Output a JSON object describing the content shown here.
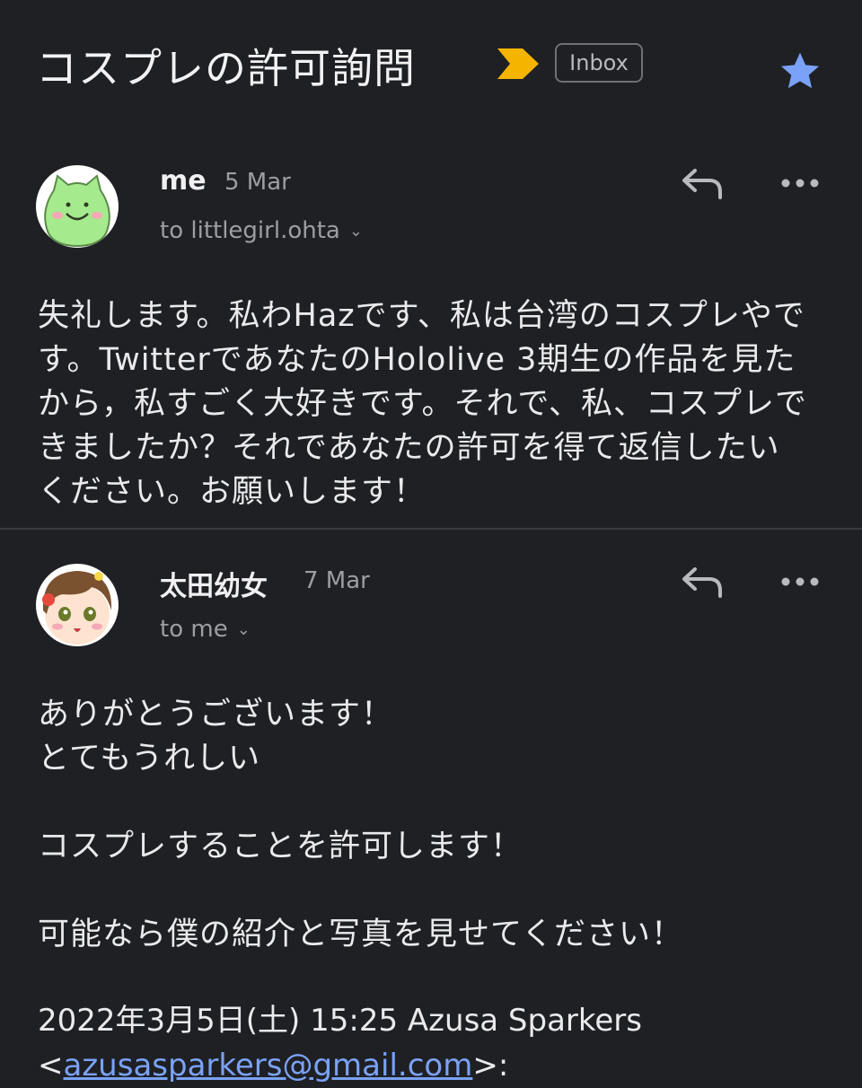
{
  "thread": {
    "subject": "コスプレの許可詢問",
    "label": "Inbox",
    "starred": true,
    "colors": {
      "background": "#1f2024",
      "importance": "#f5b400",
      "star": "#7aa2f7",
      "link": "#7aa2f7"
    }
  },
  "messages": [
    {
      "sender": "me",
      "date": "5 Mar",
      "recipient": "to littlegirl.ohta",
      "avatar_icon": "green-blob-avatar",
      "body": "失礼します。私わHazです、私は台湾のコスプレやです。TwitterであなたのHololive 3期生の作品を見たから，私すごく大好きです。それで、私、コスプレできましたか？それであなたの許可を得て返信したいください。お願いします！"
    },
    {
      "sender": "太田幼女",
      "date": "7 Mar",
      "recipient": "to me",
      "avatar_icon": "anime-girl-avatar",
      "body": "ありがとうございます！\nとてもうれしい\n\nコスプレすることを許可します！\n\n可能なら僕の紹介と写真を見せてください！",
      "quote": {
        "header": "2022年3月5日(土) 15:25 Azusa Sparkers",
        "open": "<",
        "email": "azusasparkers@gmail.com",
        "close": ">:"
      }
    }
  ]
}
